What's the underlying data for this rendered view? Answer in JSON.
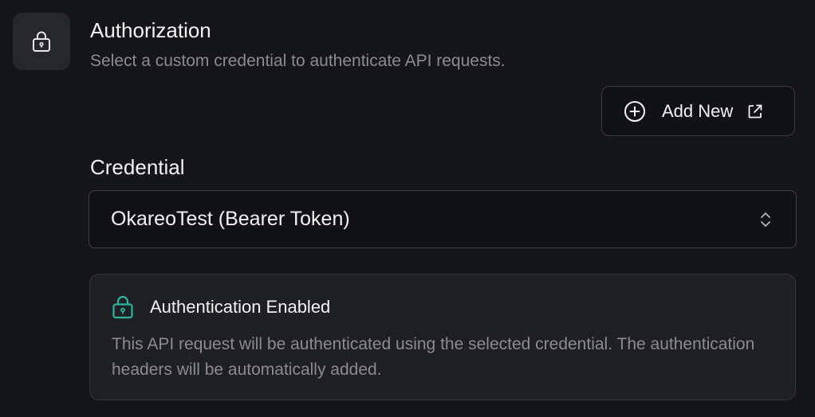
{
  "section": {
    "icon": "lock-icon",
    "title": "Authorization",
    "description": "Select a custom credential to authenticate API requests."
  },
  "add_new": {
    "label": "Add New",
    "leading_icon": "plus-circle-icon",
    "trailing_icon": "external-link-icon"
  },
  "credential": {
    "label": "Credential",
    "selected_value": "OkareoTest (Bearer Token)",
    "indicator_icon": "chevron-up-down-icon"
  },
  "info": {
    "icon": "lock-icon",
    "title": "Authentication Enabled",
    "text": "This API request will be authenticated using the selected credential. The authentication headers will be automatically added."
  },
  "colors": {
    "background": "#151619",
    "accent": "#2fb39a",
    "muted_text": "#8b8c92"
  }
}
